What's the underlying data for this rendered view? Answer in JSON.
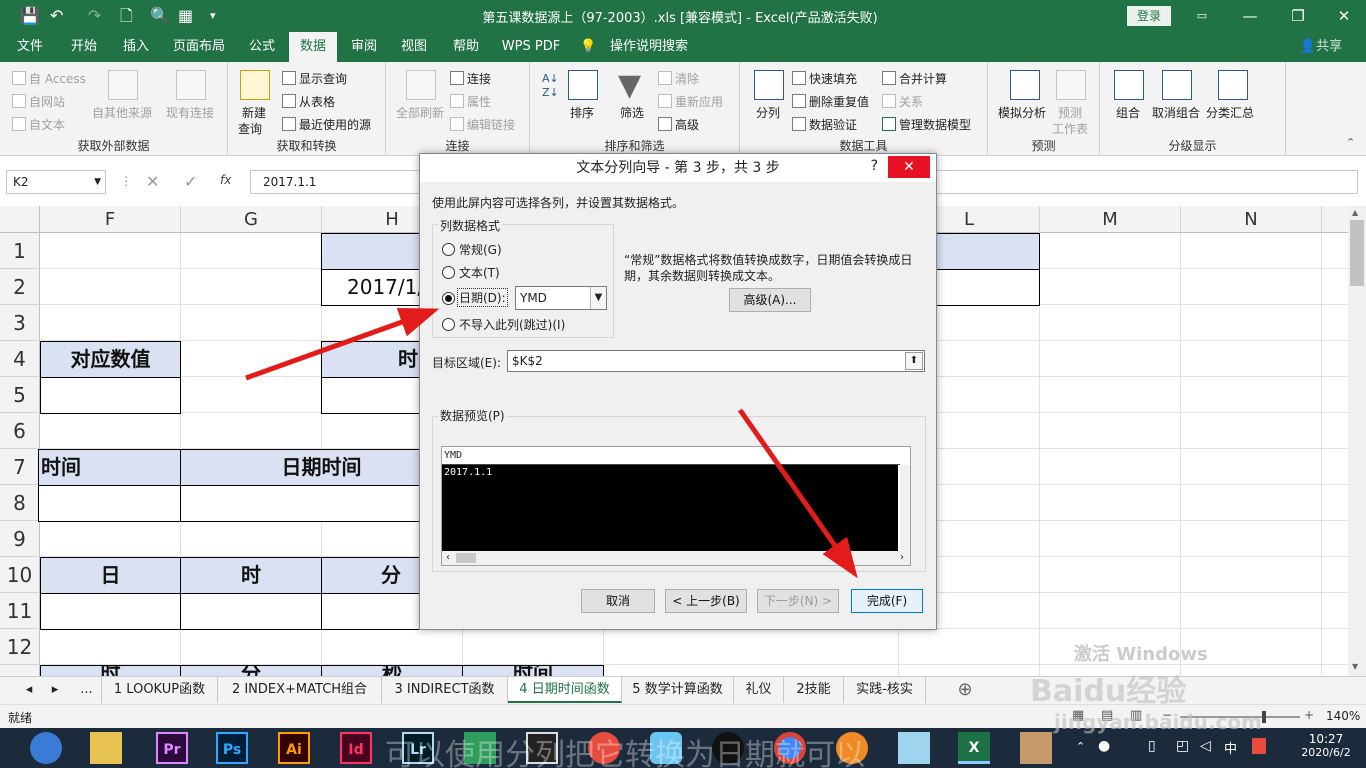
{
  "titlebar": {
    "title": "第五课数据源上（97-2003）.xls  [兼容模式] - Excel(产品激活失败)",
    "login": "登录",
    "min": "—",
    "restore": "❐",
    "close": "✕",
    "save_icon": "save-icon",
    "undo_icon": "undo-icon"
  },
  "menu": {
    "tabs": [
      "文件",
      "开始",
      "插入",
      "页面布局",
      "公式",
      "数据",
      "审阅",
      "视图",
      "帮助",
      "WPS PDF",
      "操作说明搜索"
    ],
    "active": "数据",
    "share": "共享"
  },
  "ribbon": {
    "g1": {
      "label": "获取外部数据",
      "access": "自 Access",
      "web": "自网站",
      "text": "自文本",
      "other": "自其他来源",
      "existing": "现有连接"
    },
    "g2": {
      "label": "获取和转换",
      "new_query": "新建",
      "new_query2": "查询",
      "show_query": "显示查询",
      "from_table": "从表格",
      "recent": "最近使用的源"
    },
    "g3": {
      "label": "连接",
      "refresh": "全部刷新",
      "connections": "连接",
      "properties": "属性",
      "edit_links": "编辑链接"
    },
    "g4": {
      "label": "排序和筛选",
      "sort": "排序",
      "filter": "筛选",
      "clear": "清除",
      "reapply": "重新应用",
      "advanced": "高级"
    },
    "g5": {
      "label": "数据工具",
      "split": "分列",
      "flash_fill": "快速填充",
      "remove_dup": "删除重复值",
      "validation": "数据验证",
      "consolidate": "合并计算",
      "relations": "关系",
      "model": "管理数据模型"
    },
    "g6": {
      "label": "预测",
      "whatif": "模拟分析",
      "forecast": "预测",
      "forecast2": "工作表"
    },
    "g7": {
      "label": "分级显示",
      "group": "组合",
      "ungroup": "取消组合",
      "subtotal": "分类汇总"
    }
  },
  "formula_bar": {
    "name_box": "K2",
    "formula": "2017.1.1",
    "fx": "fx"
  },
  "grid": {
    "columns": [
      "F",
      "G",
      "H",
      "L",
      "M",
      "N"
    ],
    "rows": [
      "1",
      "2",
      "3",
      "4",
      "5",
      "6",
      "7",
      "8",
      "9",
      "10",
      "11",
      "12"
    ],
    "h2": "2017/1/",
    "duiying": "对应数值",
    "shi_h4": "时",
    "shijian": "时间",
    "riqishijian": "日期时间",
    "ri": "日",
    "shi10": "时",
    "fen10": "分",
    "r13a": "时",
    "r13b": "分",
    "r13c": "秒",
    "r13d": "时间"
  },
  "dialog": {
    "title": "文本分列向导 - 第 3 步，共 3 步",
    "help": "?",
    "close": "✕",
    "intro": "使用此屏内容可选择各列，并设置其数据格式。",
    "format_group": "列数据格式",
    "opt_general": "常规(G)",
    "opt_text": "文本(T)",
    "opt_date": "日期(D):",
    "opt_skip": "不导入此列(跳过)(I)",
    "date_format": "YMD",
    "description": "“常规”数据格式将数值转换成数字，日期值会转换成日期，其余数据则转换成文本。",
    "advanced": "高级(A)...",
    "dest_label": "目标区域(E):",
    "dest_value": "$K$2",
    "preview_label": "数据预览(P)",
    "preview_header": "YMD",
    "preview_row": "2017.1.1",
    "cancel": "取消",
    "back": "< 上一步(B)",
    "next": "下一步(N) >",
    "finish": "完成(F)"
  },
  "sheets": {
    "tabs": [
      "1 LOOKUP函数",
      "2 INDEX+MATCH组合",
      "3 INDIRECT函数",
      "4 日期时间函数",
      "5 数学计算函数",
      "礼仪",
      "2技能",
      "实践-核实"
    ],
    "active": "4 日期时间函数",
    "ellipsis": "...",
    "add": "⊕"
  },
  "status": {
    "ready": "就绪",
    "zoom": "140%"
  },
  "watermark": {
    "baidu": "Baidu经验",
    "site": "jingyan.baidu.com",
    "activate": "激活 Windows"
  },
  "subtitle": "可以使用分列把它转换为日期就可以",
  "taskbar": {
    "apps": [
      "Pr",
      "Ps",
      "Ai",
      "Id",
      "Lr",
      "X"
    ],
    "time": "10:27",
    "date": "2020/6/2",
    "lang": "中"
  }
}
